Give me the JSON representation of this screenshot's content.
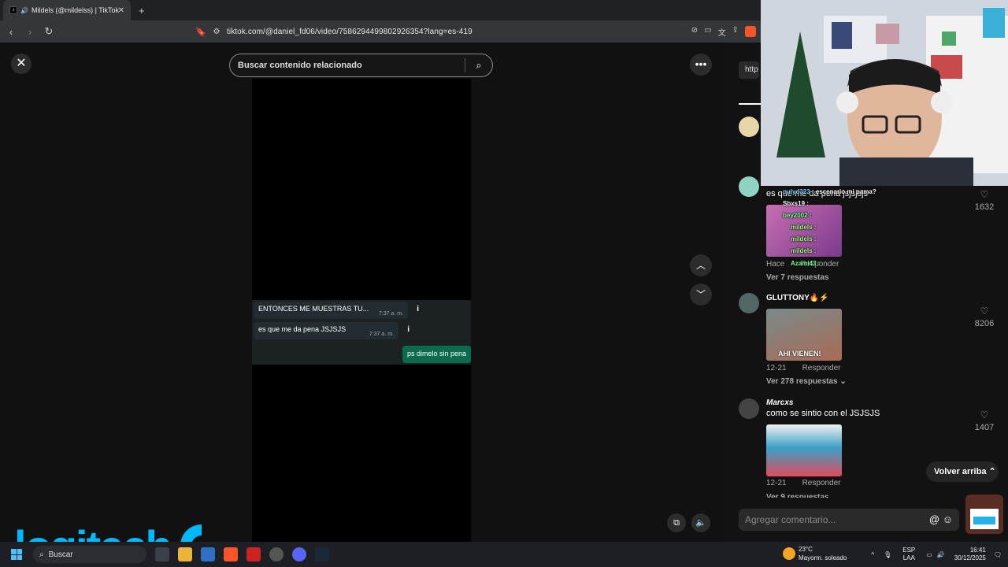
{
  "browser": {
    "tab_title": "Mildels (@mildelss) | TikTok",
    "url": "tiktok.com/@daniel_fd06/video/7586294499802926354?lang=es-419",
    "new_tab_symbol": "+"
  },
  "video": {
    "search_placeholder": "Buscar contenido relacionado",
    "chat": [
      {
        "text": "ENTONCES ME MUESTRAS TU...",
        "time": "7:37 a. m.",
        "badge": "i"
      },
      {
        "text": "es que me da pena JSJSJS",
        "time": "7:37 a. m.",
        "badge": "i"
      },
      {
        "text": "ps dimelo sin pena"
      }
    ]
  },
  "logitech": {
    "word": "logitech",
    "tm": "TM"
  },
  "comments": {
    "link_preview": "http",
    "items": [
      {
        "user": "",
        "text": "es que me da pena jsjsjsjs",
        "likes": "1632",
        "date": "",
        "reply": "Responder",
        "replies": "Ver 7 respuestas"
      },
      {
        "user": "GLUTTONY🔥⚡",
        "text": "",
        "image_caption": "AHI VIENEN!",
        "likes": "8206",
        "date": "12-21",
        "reply": "Responder",
        "replies": "Ver 278 respuestas"
      },
      {
        "user": "Marcxs",
        "text": "como se sintio con el JSJSJS",
        "likes": "1407",
        "date": "12-21",
        "reply": "Responder",
        "replies": "Ver 9 respuestas"
      }
    ],
    "hace_prefix": "Hace",
    "volver": "Volver arriba",
    "input_placeholder": "Agregar comentario...",
    "overlay": [
      {
        "name": "pulyd323 :",
        "msg": "escenario mi pama?",
        "color": "#7fd3ff"
      },
      {
        "name": "Sbxs19 :",
        "msg": "",
        "color": "#ffffff"
      },
      {
        "name": "bey2002 :",
        "msg": "",
        "color": "#7dff9a"
      },
      {
        "name": "mildels :",
        "msg": "",
        "color": "#9cff7a"
      },
      {
        "name": "mildels :",
        "msg": "",
        "color": "#9cff7a"
      },
      {
        "name": "mildels :",
        "msg": "",
        "color": "#9cff7a"
      },
      {
        "name": "Azami43 :",
        "msg": "",
        "color": "#7dff9a"
      }
    ]
  },
  "taskbar": {
    "search": "Buscar",
    "weather_temp": "23°C",
    "weather_desc": "Mayorm. soleado",
    "lang_top": "ESP",
    "lang_bottom": "LAA",
    "time": "16:41",
    "date": "30/12/2025"
  },
  "colors": {
    "accent": "#00b8fc",
    "bubble_out": "#0b6b4e",
    "panel": "#121212"
  }
}
